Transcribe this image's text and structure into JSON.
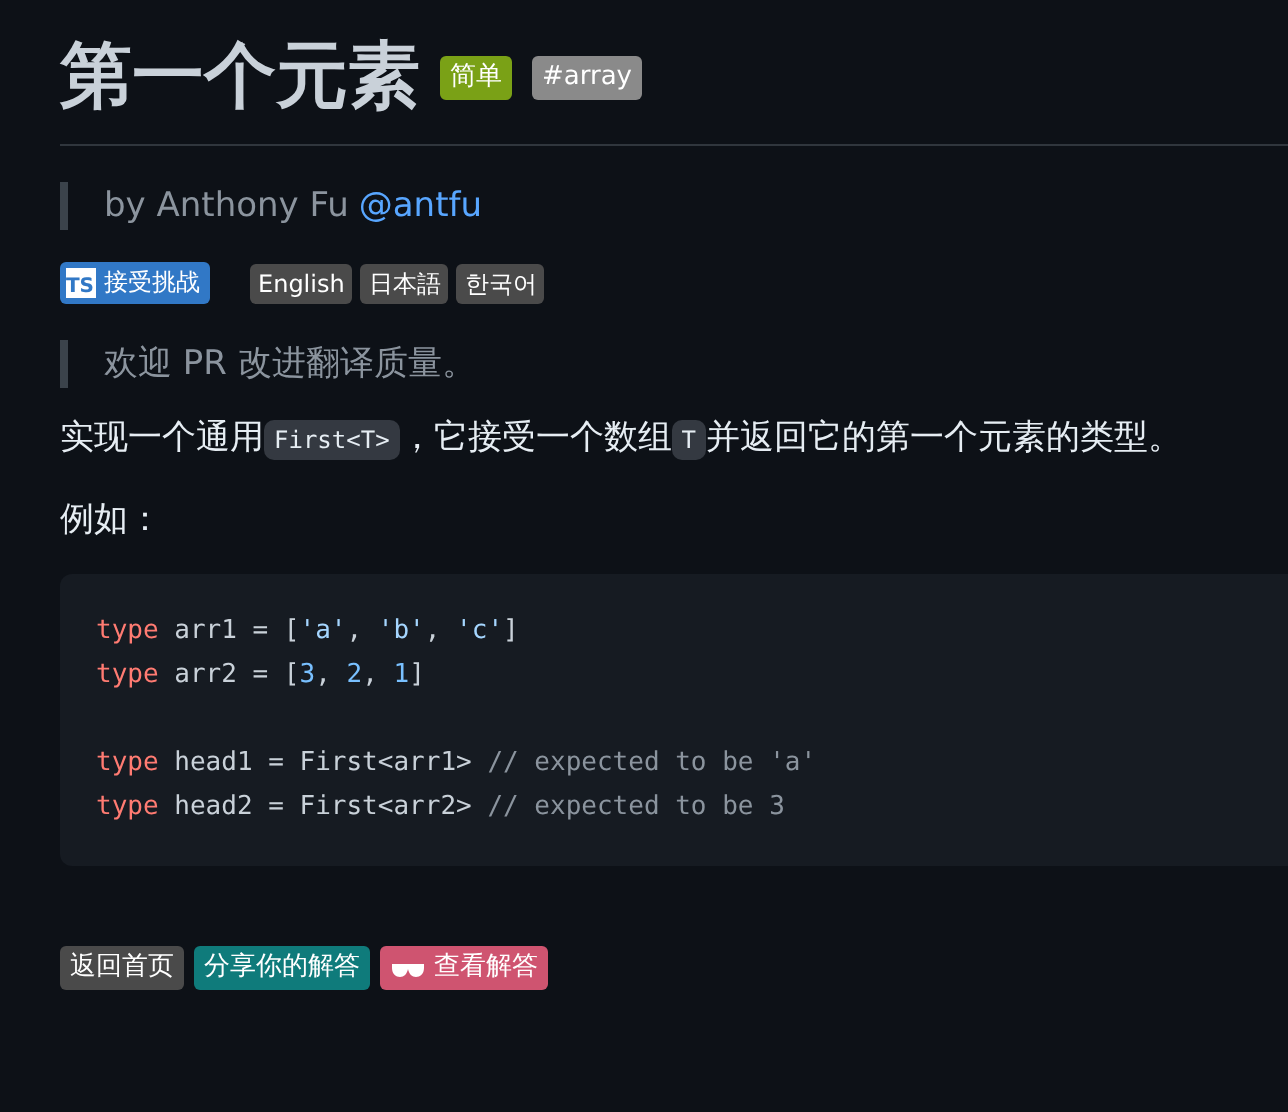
{
  "title": "第一个元素",
  "tags": [
    {
      "label": "简单",
      "color": "#7aa116"
    },
    {
      "label": "#array",
      "color": "#8a8a8a"
    }
  ],
  "author": {
    "prefix": "by Anthony Fu",
    "handle": "@antfu"
  },
  "challenge": {
    "icon_text": "TS",
    "label": "接受挑战"
  },
  "languages": [
    {
      "label": "English"
    },
    {
      "label": "日本語"
    },
    {
      "label": "한국어"
    }
  ],
  "notice": "欢迎 PR 改进翻译质量。",
  "description": [
    {
      "kind": "text",
      "text": "实现一个通用"
    },
    {
      "kind": "code",
      "text": "First<T>"
    },
    {
      "kind": "text",
      "text": "，它接受一个数组"
    },
    {
      "kind": "code",
      "text": "T"
    },
    {
      "kind": "text",
      "text": "并返回它的第一个元素的类型。"
    }
  ],
  "example_label": "例如：",
  "code": [
    {
      "kind": "code",
      "tokens": [
        {
          "kind": "keyword",
          "text": "type"
        },
        {
          "kind": "plain",
          "text": " arr1 = ["
        },
        {
          "kind": "string",
          "text": "'a'"
        },
        {
          "kind": "plain",
          "text": ", "
        },
        {
          "kind": "string",
          "text": "'b'"
        },
        {
          "kind": "plain",
          "text": ", "
        },
        {
          "kind": "string",
          "text": "'c'"
        },
        {
          "kind": "plain",
          "text": "]"
        }
      ]
    },
    {
      "kind": "code",
      "tokens": [
        {
          "kind": "keyword",
          "text": "type"
        },
        {
          "kind": "plain",
          "text": " arr2 = ["
        },
        {
          "kind": "number",
          "text": "3"
        },
        {
          "kind": "plain",
          "text": ", "
        },
        {
          "kind": "number",
          "text": "2"
        },
        {
          "kind": "plain",
          "text": ", "
        },
        {
          "kind": "number",
          "text": "1"
        },
        {
          "kind": "plain",
          "text": "]"
        }
      ]
    },
    {
      "kind": "blank"
    },
    {
      "kind": "code",
      "tokens": [
        {
          "kind": "keyword",
          "text": "type"
        },
        {
          "kind": "plain",
          "text": " head1 = First<arr1> "
        },
        {
          "kind": "comment",
          "text": "// expected to be 'a'"
        }
      ]
    },
    {
      "kind": "code",
      "tokens": [
        {
          "kind": "keyword",
          "text": "type"
        },
        {
          "kind": "plain",
          "text": " head2 = First<arr2> "
        },
        {
          "kind": "comment",
          "text": "// expected to be 3"
        }
      ]
    }
  ],
  "footer_buttons": [
    {
      "kind": "plain",
      "label": "返回首页",
      "color": "#4a4a4a"
    },
    {
      "kind": "plain",
      "label": "分享你的解答",
      "color": "#0f7b7b"
    },
    {
      "kind": "with_icon",
      "label": "查看解答",
      "color": "#cf5470"
    }
  ]
}
